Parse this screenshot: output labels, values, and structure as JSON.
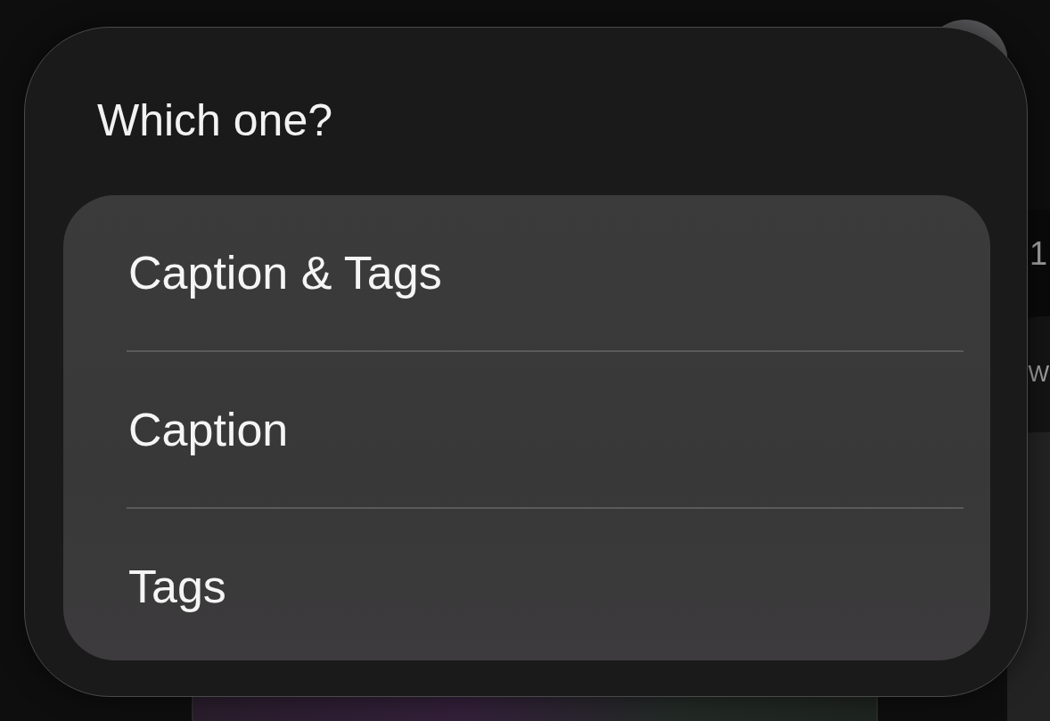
{
  "background_text": [
    "1",
    "W"
  ],
  "dialog": {
    "title": "Which one?",
    "options": [
      {
        "label": "Caption & Tags"
      },
      {
        "label": "Caption"
      },
      {
        "label": "Tags"
      }
    ]
  }
}
